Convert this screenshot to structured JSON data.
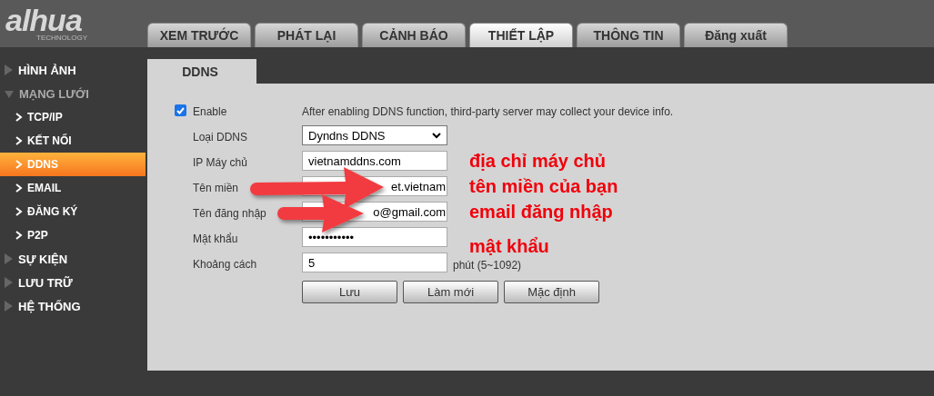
{
  "logo": {
    "brand": "alhua",
    "tagline": "TECHNOLOGY"
  },
  "tabs": [
    {
      "label": "XEM TRƯỚC",
      "selected": false
    },
    {
      "label": "PHÁT LẠI",
      "selected": false
    },
    {
      "label": "CẢNH BÁO",
      "selected": false
    },
    {
      "label": "THIẾT LẬP",
      "selected": true
    },
    {
      "label": "THÔNG TIN",
      "selected": false
    },
    {
      "label": "Đăng xuất",
      "selected": false
    }
  ],
  "sidebar": {
    "items": [
      {
        "label": "HÌNH ẢNH",
        "expanded": false
      },
      {
        "label": "MẠNG LƯỚI",
        "expanded": true,
        "children": [
          {
            "label": "TCP/IP",
            "selected": false
          },
          {
            "label": "KẾT NỐI",
            "selected": false
          },
          {
            "label": "DDNS",
            "selected": true
          },
          {
            "label": "EMAIL",
            "selected": false
          },
          {
            "label": "ĐĂNG KÝ",
            "selected": false
          },
          {
            "label": "P2P",
            "selected": false
          }
        ]
      },
      {
        "label": "SỰ KIỆN",
        "expanded": false
      },
      {
        "label": "LƯU TRỮ",
        "expanded": false
      },
      {
        "label": "HỆ THỐNG",
        "expanded": false
      }
    ]
  },
  "page": {
    "title": "DDNS",
    "enable": {
      "label": "Enable",
      "checked": true,
      "description": "After enabling DDNS function, third-party server may collect your device info."
    },
    "fields": [
      {
        "label": "Loại DDNS",
        "kind": "select",
        "value": "Dyndns DDNS"
      },
      {
        "label": "IP Máy chủ",
        "kind": "text",
        "value": "vietnamddns.com",
        "note": "địa chỉ máy chủ"
      },
      {
        "label": "Tên miền",
        "kind": "covered",
        "value": "et.vietnam",
        "note": "tên miền của bạn"
      },
      {
        "label": "Tên đăng nhập",
        "kind": "covered",
        "value": "o@gmail.com",
        "note": "email đăng nhập"
      },
      {
        "label": "Mật khẩu",
        "kind": "text",
        "value": "•••••••••••",
        "note": "mật khẩu"
      },
      {
        "label": "Khoảng cách",
        "kind": "unit",
        "value": "5",
        "unit": "phút (5~1092)"
      }
    ],
    "buttons": [
      "Lưu",
      "Làm mới",
      "Mặc định"
    ]
  }
}
